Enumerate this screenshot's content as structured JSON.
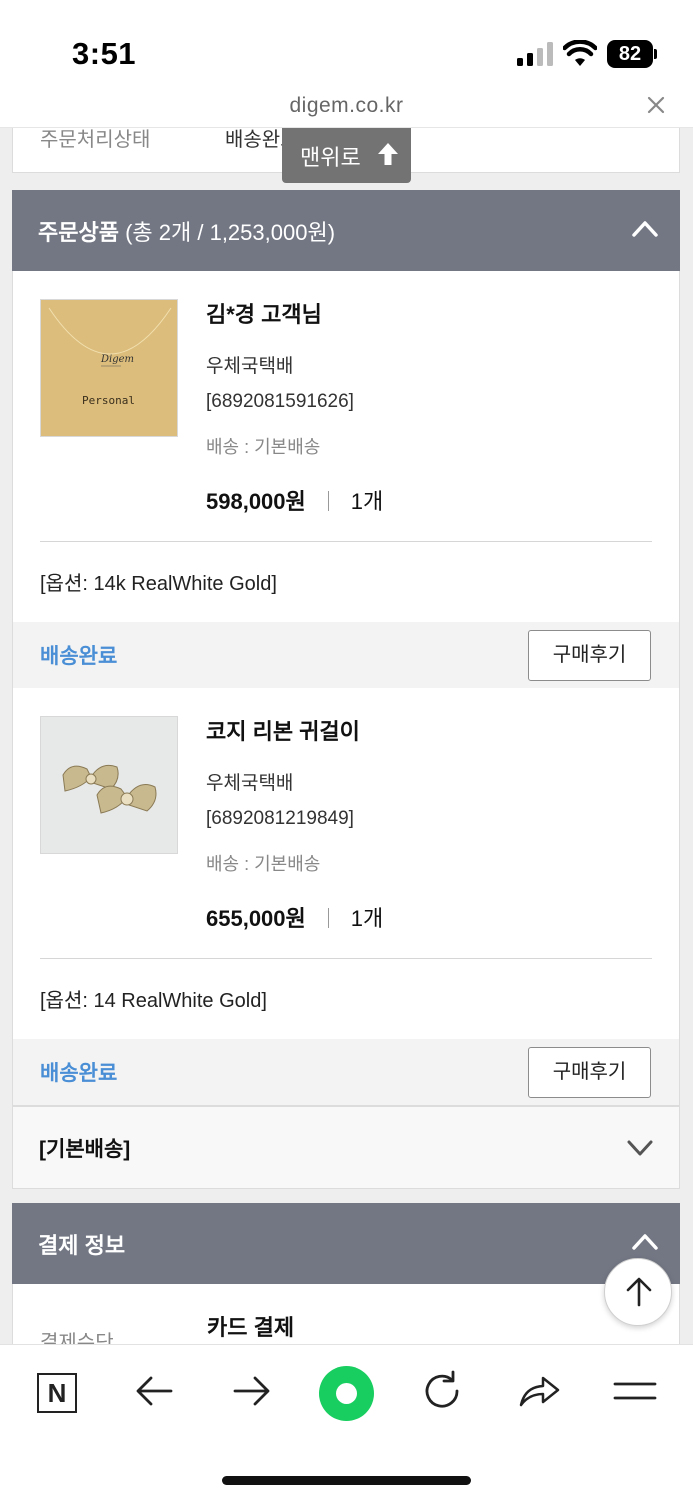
{
  "status_bar": {
    "time": "3:51",
    "battery": "82"
  },
  "browser": {
    "url": "digem.co.kr"
  },
  "top_row": {
    "label": "주문처리상태",
    "value": "배송완료"
  },
  "to_top_chip": {
    "label": "맨위로"
  },
  "order_section": {
    "title": "주문상품",
    "summary": "(총 2개 / 1,253,000원)"
  },
  "items": [
    {
      "name": "김*경 고객님",
      "courier": "우체국택배",
      "tracking": "[6892081591626]",
      "shipping": "배송 : 기본배송",
      "price": "598,000원",
      "qty": "1개",
      "option": "[옵션: 14k RealWhite Gold]",
      "status": "배송완료",
      "review_label": "구매후기",
      "thumb_text_top": "Digem",
      "thumb_text": "Personal"
    },
    {
      "name": "코지 리본 귀걸이",
      "courier": "우체국택배",
      "tracking": "[6892081219849]",
      "shipping": "배송 : 기본배송",
      "price": "655,000원",
      "qty": "1개",
      "option": "[옵션: 14 RealWhite Gold]",
      "status": "배송완료",
      "review_label": "구매후기"
    }
  ],
  "basic_shipping": {
    "title": "[기본배송]"
  },
  "payment_section": {
    "title": "결제 정보",
    "method_label": "결제수단",
    "method_value": "카드 결제"
  },
  "toolbar": {
    "n_label": "N"
  },
  "colors": {
    "header_bg": "#737784",
    "status_blue": "#4a8fd6",
    "naver_green": "#19ce60"
  },
  "icons": [
    "close-icon",
    "arrow-up-icon",
    "chevron-up-icon",
    "chevron-down-icon",
    "back-icon",
    "forward-icon",
    "reload-icon",
    "share-icon",
    "menu-icon"
  ]
}
